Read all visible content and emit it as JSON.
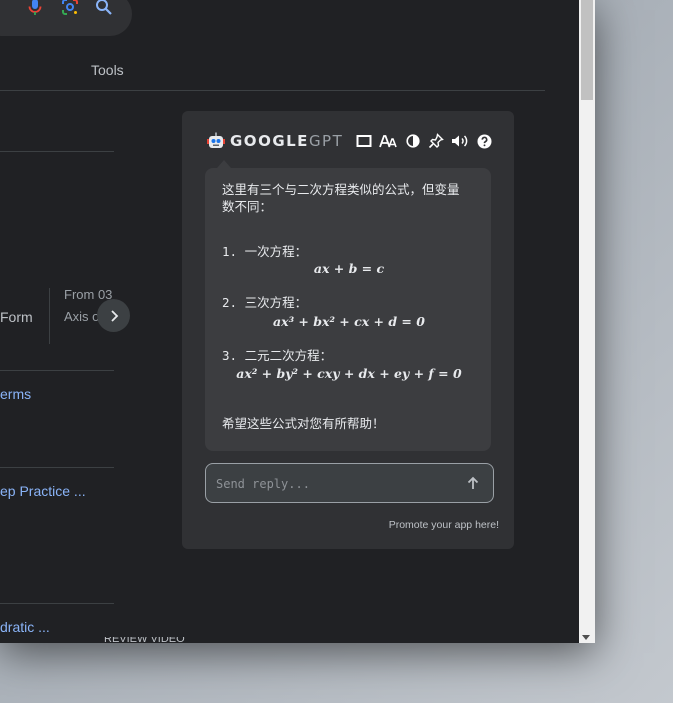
{
  "serp": {
    "tools_label": "Tools",
    "card": {
      "label_left": "Form",
      "from_line1": "From 03",
      "from_line2": "Axis o"
    },
    "links": [
      "erms",
      "ep Practice ...",
      "dratic ..."
    ],
    "bottom_cut_text": "REVIEW VIDEO"
  },
  "panel": {
    "brand_primary": "GOOGLE",
    "brand_secondary": "GPT",
    "toolbar_icons": [
      "window-icon",
      "font-size-icon",
      "contrast-icon",
      "pin-icon",
      "speaker-icon",
      "help-icon"
    ],
    "message": {
      "intro_line1": "这里有三个与二次方程类似的公式，但变量",
      "intro_line2": "数不同：",
      "items": [
        {
          "label": "1. 一次方程：",
          "formula": "ax + b = c"
        },
        {
          "label": "2. 三次方程：",
          "formula": "ax³ + bx² + cx + d = 0"
        },
        {
          "label": "3. 二元二次方程：",
          "formula": "ax² + by² + cxy + dx + ey + f = 0"
        }
      ],
      "outro": "希望这些公式对您有所帮助！"
    },
    "reply_placeholder": "Send reply...",
    "promote_text": "Promote your app here!"
  },
  "colors": {
    "page_bg": "#202124",
    "panel_bg": "#303134",
    "bubble_bg": "#3c3d40",
    "link": "#8ab4f8",
    "text": "#e8eaed"
  }
}
